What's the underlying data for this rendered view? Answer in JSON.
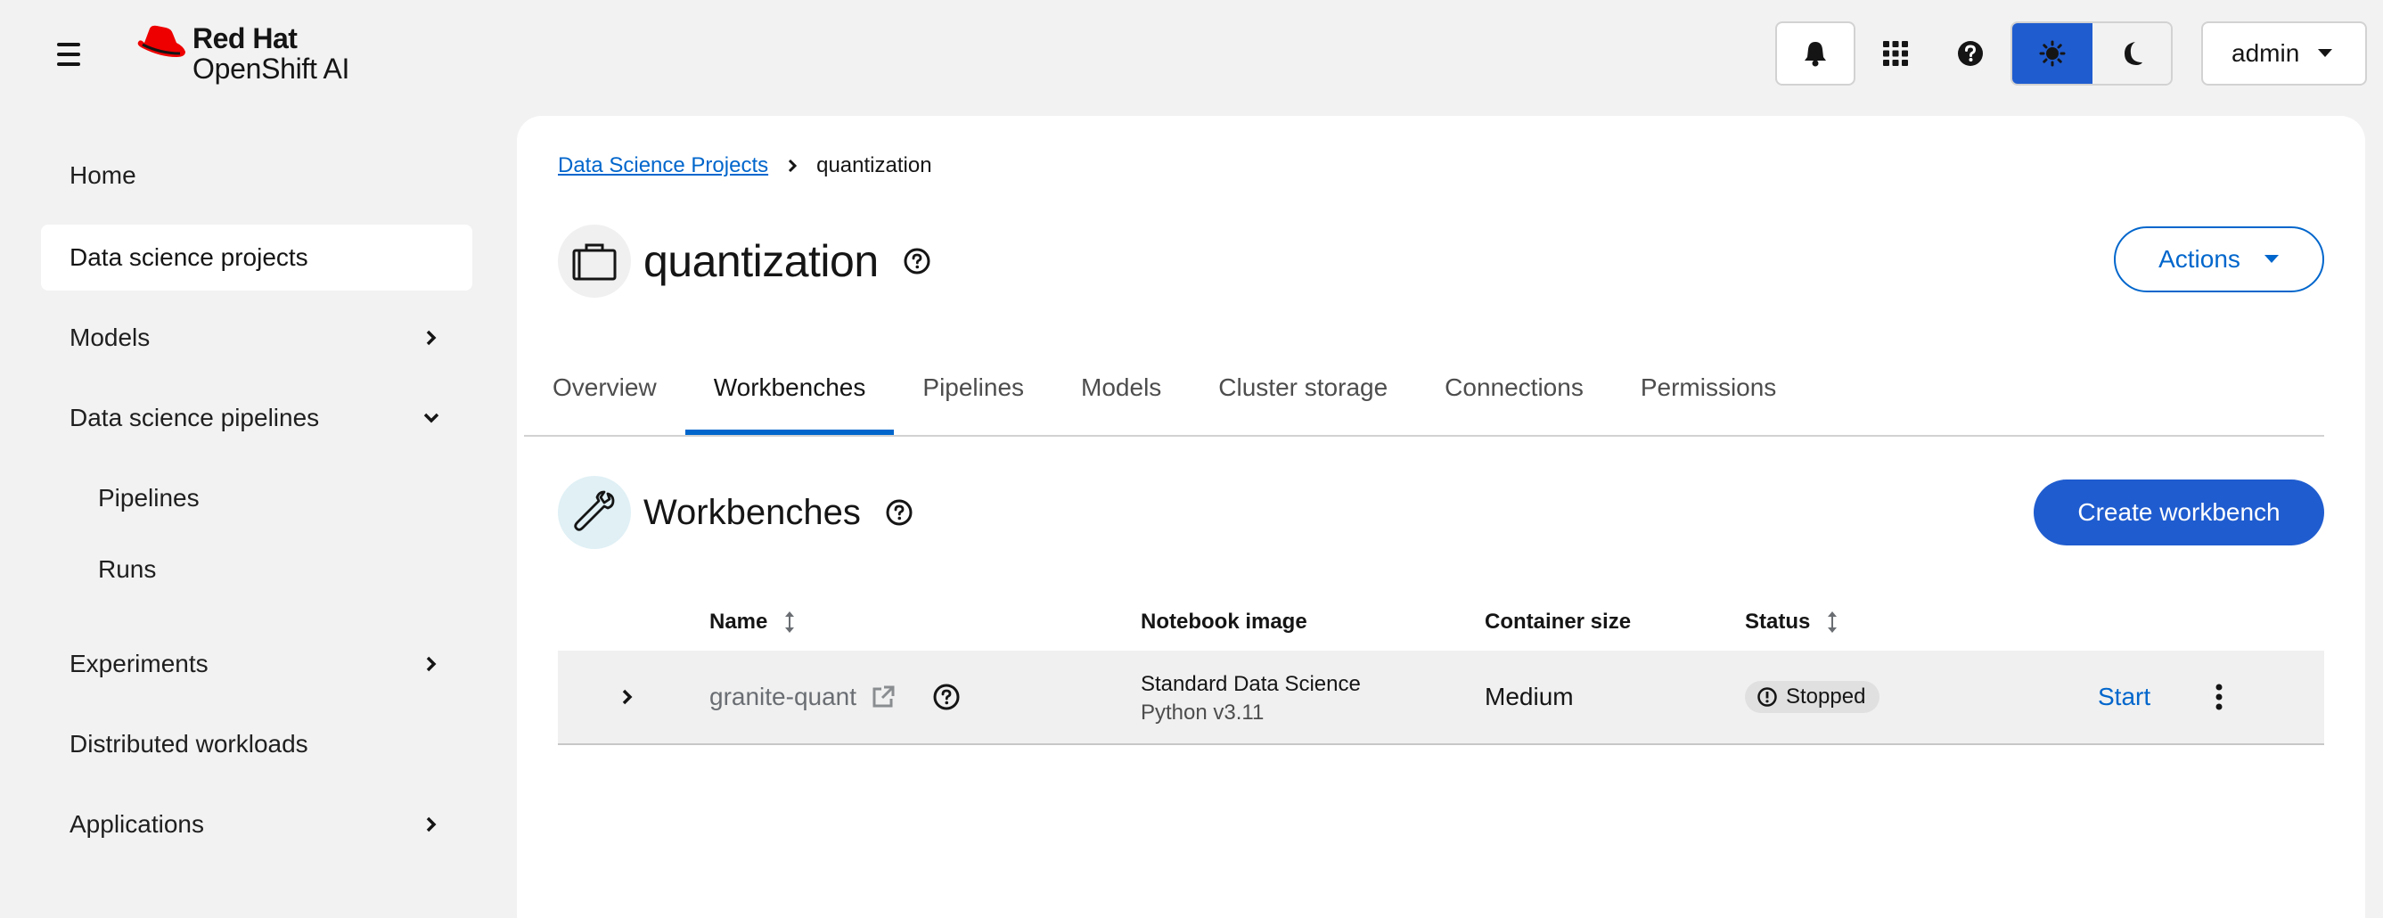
{
  "masthead": {
    "brand": "Red Hat",
    "product": "OpenShift AI",
    "user": "admin",
    "colors": {
      "accent": "#1f5ccf",
      "logo_red": "#ee0000"
    }
  },
  "sidebar": {
    "items": [
      {
        "label": "Home"
      },
      {
        "label": "Data science projects"
      },
      {
        "label": "Models"
      },
      {
        "label": "Data science pipelines"
      },
      {
        "label": "Pipelines"
      },
      {
        "label": "Runs"
      },
      {
        "label": "Experiments"
      },
      {
        "label": "Distributed workloads"
      },
      {
        "label": "Applications"
      }
    ]
  },
  "breadcrumb": {
    "parent": "Data Science Projects",
    "current": "quantization"
  },
  "project": {
    "title": "quantization",
    "actions_label": "Actions"
  },
  "tabs": [
    {
      "label": "Overview"
    },
    {
      "label": "Workbenches"
    },
    {
      "label": "Pipelines"
    },
    {
      "label": "Models"
    },
    {
      "label": "Cluster storage"
    },
    {
      "label": "Connections"
    },
    {
      "label": "Permissions"
    }
  ],
  "workbenches": {
    "title": "Workbenches",
    "create_label": "Create workbench",
    "columns": {
      "name": "Name",
      "image": "Notebook image",
      "size": "Container size",
      "status": "Status"
    },
    "rows": [
      {
        "name": "granite-quant",
        "image_name": "Standard Data Science",
        "image_version": "Python v3.11",
        "size": "Medium",
        "status": "Stopped",
        "action": "Start"
      }
    ]
  }
}
